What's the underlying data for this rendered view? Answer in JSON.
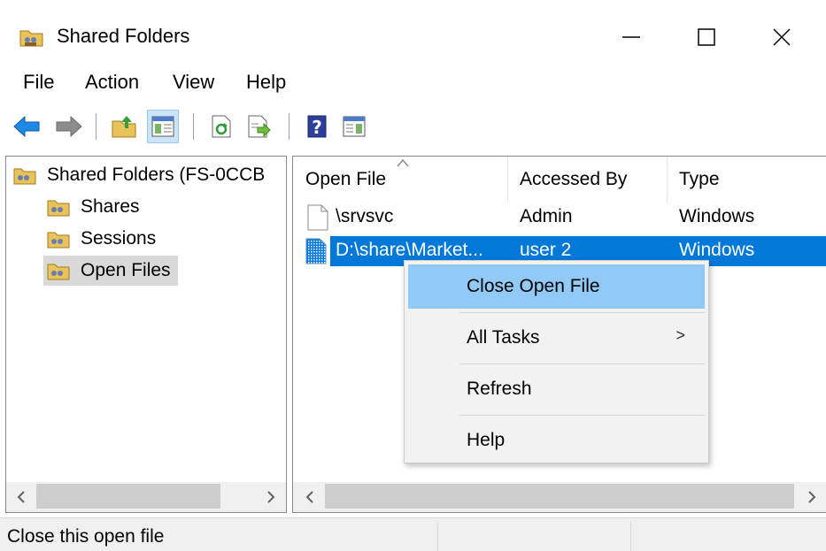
{
  "window": {
    "title": "Shared Folders",
    "minimize_glyph": "—",
    "close_glyph": "✕"
  },
  "menu": {
    "items": [
      "File",
      "Action",
      "View",
      "Help"
    ]
  },
  "toolbar": {
    "icons": [
      "back-arrow-icon",
      "forward-arrow-icon",
      "up-folder-icon",
      "show-hide-console-tree-icon",
      "refresh-icon",
      "export-list-icon",
      "help-icon",
      "show-action-pane-icon"
    ]
  },
  "tree": {
    "root": "Shared Folders (FS-0CCB",
    "items": [
      "Shares",
      "Sessions",
      "Open Files"
    ],
    "selected": "Open Files"
  },
  "list": {
    "columns": [
      "Open File",
      "Accessed By",
      "Type"
    ],
    "rows": [
      {
        "open_file": "\\srvsvc",
        "accessed_by": "Admin",
        "type": "Windows"
      },
      {
        "open_file": "D:\\share\\Market...",
        "accessed_by": "user 2",
        "type": "Windows"
      }
    ]
  },
  "context_menu": {
    "items": [
      "Close Open File",
      "All Tasks",
      "Refresh",
      "Help"
    ],
    "highlighted": "Close Open File",
    "submenu_glyph": ">"
  },
  "statusbar": {
    "text": "Close this open file"
  },
  "colors": {
    "selection": "#0078d7",
    "menu_hover": "#91c9f7",
    "tree_selected": "#d9d9d9"
  }
}
